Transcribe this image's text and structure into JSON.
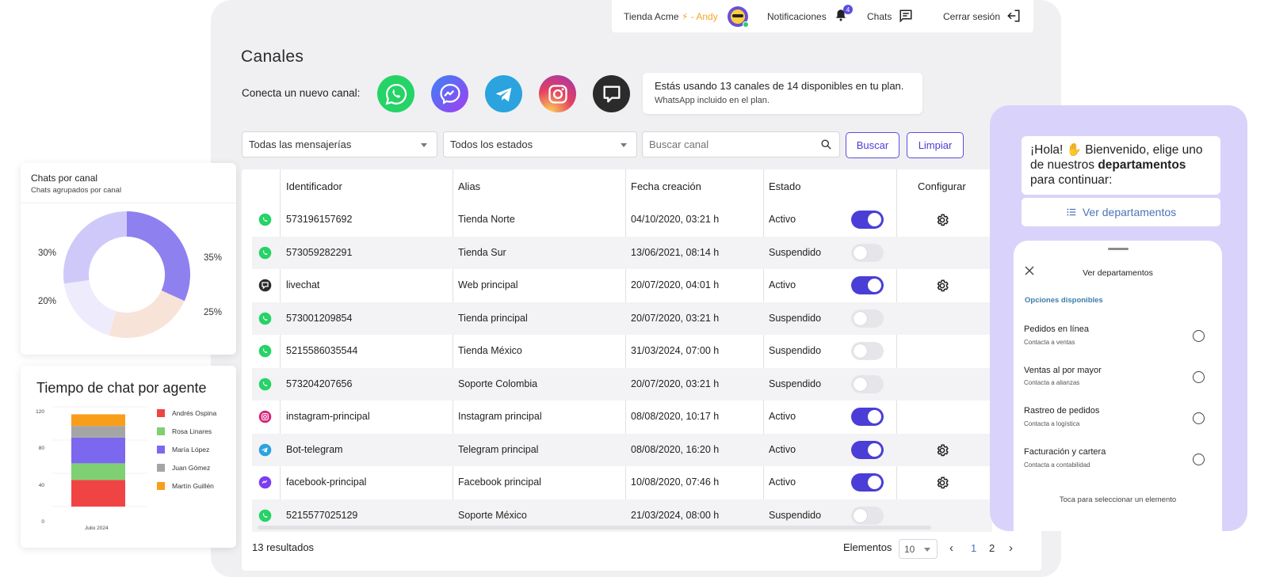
{
  "topbar": {
    "store": "Tienda Acme",
    "separator": "⚡ - Andy",
    "notifications_label": "Notificaciones",
    "notifications_count": "4",
    "chats_label": "Chats",
    "logout_label": "Cerrar sesión"
  },
  "page": {
    "title": "Canales",
    "connect_label": "Conecta un nuevo canal:",
    "channel_options": [
      "whatsapp",
      "messenger",
      "telegram",
      "instagram",
      "livechat"
    ],
    "info_line1": "Estás usando 13 canales de 14 disponibles en tu plan.",
    "info_line2": "WhatsApp incluido en el plan."
  },
  "filters": {
    "messaging_value": "Todas las mensajerías",
    "status_value": "Todos los estados",
    "search_placeholder": "Buscar canal",
    "search_button": "Buscar",
    "clear_button": "Limpiar"
  },
  "table": {
    "headers": [
      "Identificador",
      "Alias",
      "Fecha creación",
      "Estado",
      "Configurar"
    ],
    "rows": [
      {
        "type": "whatsapp",
        "id": "573196157692",
        "alias": "Tienda Norte",
        "date": "04/10/2020, 03:21 h",
        "status": "Activo",
        "on": true,
        "config": true
      },
      {
        "type": "whatsapp",
        "id": "573059282291",
        "alias": "Tienda Sur",
        "date": "13/06/2021, 08:14 h",
        "status": "Suspendido",
        "on": false,
        "config": false
      },
      {
        "type": "livechat",
        "id": "livechat",
        "alias": "Web principal",
        "date": "20/07/2020, 04:01 h",
        "status": "Activo",
        "on": true,
        "config": true
      },
      {
        "type": "whatsapp",
        "id": "573001209854",
        "alias": "Tienda principal",
        "date": "20/07/2020, 03:21 h",
        "status": "Suspendido",
        "on": false,
        "config": false
      },
      {
        "type": "whatsapp",
        "id": "5215586035544",
        "alias": "Tienda México",
        "date": "31/03/2024, 07:00 h",
        "status": "Suspendido",
        "on": false,
        "config": false
      },
      {
        "type": "whatsapp",
        "id": "573204207656",
        "alias": "Soporte Colombia",
        "date": "20/07/2020, 03:21 h",
        "status": "Suspendido",
        "on": false,
        "config": false
      },
      {
        "type": "instagram",
        "id": "instagram-principal",
        "alias": "Instagram principal",
        "date": "08/08/2020, 10:17 h",
        "status": "Activo",
        "on": true,
        "config": false
      },
      {
        "type": "telegram",
        "id": "Bot-telegram",
        "alias": "Telegram principal",
        "date": "08/08/2020, 16:20 h",
        "status": "Activo",
        "on": true,
        "config": true
      },
      {
        "type": "messenger",
        "id": "facebook-principal",
        "alias": "Facebook principal",
        "date": "10/08/2020, 07:46 h",
        "status": "Activo",
        "on": true,
        "config": true
      },
      {
        "type": "whatsapp",
        "id": "5215577025129",
        "alias": "Soporte México",
        "date": "21/03/2024, 08:00 h",
        "status": "Suspendido",
        "on": false,
        "config": false
      }
    ],
    "results": "13 resultados",
    "elements_label": "Elementos",
    "page_size": "10",
    "pages": [
      "1",
      "2"
    ]
  },
  "donut": {
    "title": "Chats por canal",
    "subtitle": "Chats agrupados por canal",
    "labels": [
      "35%",
      "25%",
      "20%",
      "30%"
    ]
  },
  "bar": {
    "title": "Tiempo de chat por agente",
    "yticks": [
      "120",
      "80",
      "40",
      "0"
    ],
    "xlabel": "Julio 2024"
  },
  "colors": {
    "accent": "#4a3ed6",
    "whatsapp": "#25d366",
    "messenger": "#7b3ff2",
    "telegram": "#2aa3df",
    "instagram": "#d6287a",
    "livechat": "#2b2b2b",
    "phone_bg": "#d9d3fb"
  },
  "chart_data": [
    {
      "type": "pie",
      "title": "Chats por canal",
      "subtitle": "Chats agrupados por canal",
      "values": [
        35,
        25,
        20,
        30
      ],
      "colors": [
        "#8f80f0",
        "#f8e3d8",
        "#eeebfc",
        "#cfc9fa"
      ]
    },
    {
      "type": "bar",
      "stacked": true,
      "title": "Tiempo de chat por agente",
      "categories": [
        "Julio 2024"
      ],
      "ylim": [
        0,
        120
      ],
      "series": [
        {
          "name": "Andrés Ospina",
          "color": "#f04444",
          "values": [
            32
          ]
        },
        {
          "name": "Rosa Linares",
          "color": "#7fcf73",
          "values": [
            20
          ]
        },
        {
          "name": "María López",
          "color": "#7b68ee",
          "values": [
            31
          ]
        },
        {
          "name": "Juan Gómez",
          "color": "#a5a5a5",
          "values": [
            14
          ]
        },
        {
          "name": "Martín Guillén",
          "color": "#f89e1b",
          "values": [
            14
          ]
        }
      ]
    }
  ],
  "chat": {
    "greeting_pre": "¡Hola! ✋ Bienvenido, elige uno de nuestros",
    "greeting_bold": "departamentos",
    "greeting_post": "para continuar:",
    "view_button": "Ver departamentos",
    "sheet_title": "Ver departamentos",
    "options_label": "Opciones disponibles",
    "options": [
      {
        "title": "Pedidos en línea",
        "sub": "Contacta a ventas"
      },
      {
        "title": "Ventas al por mayor",
        "sub": "Contacta a alianzas"
      },
      {
        "title": "Rastreo de pedidos",
        "sub": "Contacta a logística"
      },
      {
        "title": "Facturación y cartera",
        "sub": "Contacta a contabilidad"
      }
    ],
    "hint": "Toca para seleccionar un elemento"
  }
}
